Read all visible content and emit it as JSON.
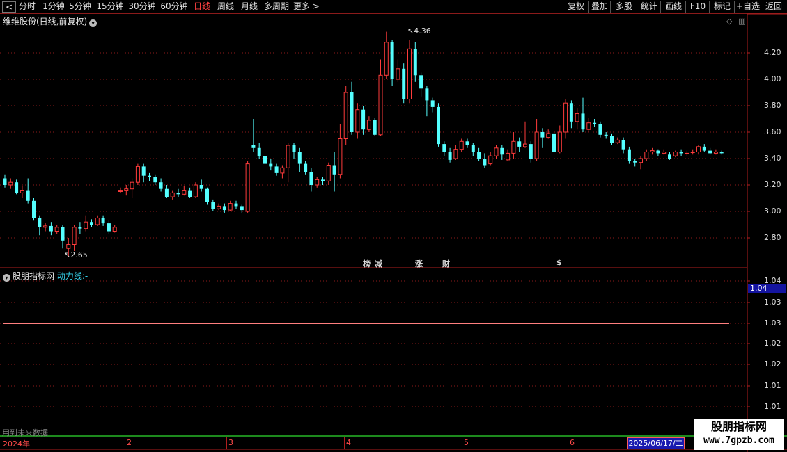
{
  "toolbar": {
    "periods": [
      {
        "label": "分时",
        "active": false
      },
      {
        "label": "1分钟",
        "active": false
      },
      {
        "label": "5分钟",
        "active": false
      },
      {
        "label": "15分钟",
        "active": false
      },
      {
        "label": "30分钟",
        "active": false
      },
      {
        "label": "60分钟",
        "active": false
      },
      {
        "label": "日线",
        "active": true
      },
      {
        "label": "周线",
        "active": false
      },
      {
        "label": "月线",
        "active": false
      },
      {
        "label": "多周期",
        "active": false
      },
      {
        "label": "更多",
        "active": false
      }
    ],
    "actions": [
      "复权",
      "叠加",
      "多股",
      "统计",
      "画线",
      "F10",
      "标记",
      "+自选",
      "返回"
    ]
  },
  "main_chart": {
    "title": "维维股份(日线,前复权)",
    "high_label": "4.36",
    "low_label": "2.65",
    "y_axis": [
      "4.20",
      "4.00",
      "3.80",
      "3.60",
      "3.40",
      "3.20",
      "3.00",
      "2.80"
    ],
    "markers": [
      {
        "text": "榜",
        "color": "#ff4040"
      },
      {
        "text": "减",
        "color": "#40e040"
      },
      {
        "text": "涨",
        "color": "#ff4040"
      },
      {
        "text": "财",
        "color": "#4080ff"
      },
      {
        "text": "$",
        "color": "#ff4040"
      }
    ]
  },
  "indicator": {
    "name": "股朋指标网",
    "line_label": "动力线:",
    "line_value": "-",
    "current_value": "1.04",
    "y_axis": [
      "1.04",
      "1.03",
      "1.03",
      "1.02",
      "1.02",
      "1.01",
      "1.01"
    ]
  },
  "footer": {
    "future_text": "用到未来数据",
    "dates": [
      "2024年",
      "2",
      "3",
      "4",
      "5",
      "6"
    ],
    "highlight_date": "2025/06/17/二"
  },
  "watermark": {
    "line1": "股朋指标网",
    "line2": "www.7gpzb.com"
  },
  "colors": {
    "up": "#ff3b3b",
    "down": "#54ffff",
    "grid": "#8b1a1a",
    "axis": "#b01e1e",
    "dynamic_line": "#ff7f7f"
  },
  "chart_data": {
    "type": "candlestick",
    "price_range": [
      2.6,
      4.4
    ],
    "candles": [
      [
        3.25,
        3.2,
        3.28,
        3.18
      ],
      [
        3.2,
        3.22,
        3.25,
        3.17
      ],
      [
        3.22,
        3.14,
        3.24,
        3.13
      ],
      [
        3.14,
        3.16,
        3.19,
        3.1
      ],
      [
        3.16,
        3.08,
        3.25,
        3.06
      ],
      [
        3.08,
        2.95,
        3.1,
        2.93
      ],
      [
        2.95,
        2.88,
        2.97,
        2.82
      ],
      [
        2.88,
        2.89,
        2.91,
        2.85
      ],
      [
        2.89,
        2.85,
        2.92,
        2.82
      ],
      [
        2.85,
        2.88,
        2.9,
        2.83
      ],
      [
        2.88,
        2.78,
        2.9,
        2.72
      ],
      [
        2.72,
        2.75,
        2.8,
        2.66
      ],
      [
        2.75,
        2.88,
        2.9,
        2.7
      ],
      [
        2.88,
        2.87,
        2.92,
        2.83
      ],
      [
        2.87,
        2.92,
        2.97,
        2.85
      ],
      [
        2.92,
        2.9,
        2.94,
        2.88
      ],
      [
        2.9,
        2.95,
        2.97,
        2.89
      ],
      [
        2.95,
        2.91,
        2.97,
        2.89
      ],
      [
        2.91,
        2.85,
        2.93,
        2.83
      ],
      [
        2.85,
        2.88,
        2.9,
        2.84
      ],
      [
        3.15,
        3.16,
        3.18,
        3.14
      ],
      [
        3.16,
        3.17,
        3.2,
        3.12
      ],
      [
        3.17,
        3.22,
        3.25,
        3.1
      ],
      [
        3.22,
        3.34,
        3.36,
        3.2
      ],
      [
        3.34,
        3.27,
        3.36,
        3.22
      ],
      [
        3.27,
        3.26,
        3.29,
        3.23
      ],
      [
        3.26,
        3.22,
        3.28,
        3.2
      ],
      [
        3.22,
        3.17,
        3.25,
        3.15
      ],
      [
        3.17,
        3.11,
        3.2,
        3.1
      ],
      [
        3.11,
        3.14,
        3.16,
        3.09
      ],
      [
        3.14,
        3.13,
        3.17,
        3.11
      ],
      [
        3.13,
        3.16,
        3.19,
        3.12
      ],
      [
        3.16,
        3.11,
        3.18,
        3.1
      ],
      [
        3.11,
        3.2,
        3.22,
        3.1
      ],
      [
        3.2,
        3.17,
        3.24,
        3.15
      ],
      [
        3.17,
        3.07,
        3.18,
        3.05
      ],
      [
        3.07,
        3.02,
        3.09,
        3.0
      ],
      [
        3.02,
        3.04,
        3.06,
        3.01
      ],
      [
        3.04,
        3.01,
        3.06,
        2.99
      ],
      [
        3.01,
        3.06,
        3.08,
        3.0
      ],
      [
        3.06,
        3.04,
        3.08,
        3.02
      ],
      [
        3.04,
        3.01,
        3.05,
        2.99
      ],
      [
        3.0,
        3.36,
        3.38,
        2.99
      ],
      [
        3.5,
        3.48,
        3.7,
        3.45
      ],
      [
        3.48,
        3.42,
        3.52,
        3.4
      ],
      [
        3.42,
        3.36,
        3.44,
        3.33
      ],
      [
        3.36,
        3.34,
        3.4,
        3.31
      ],
      [
        3.34,
        3.29,
        3.36,
        3.27
      ],
      [
        3.29,
        3.33,
        3.35,
        3.25
      ],
      [
        3.33,
        3.5,
        3.52,
        3.22
      ],
      [
        3.5,
        3.45,
        3.52,
        3.4
      ],
      [
        3.45,
        3.36,
        3.48,
        3.3
      ],
      [
        3.36,
        3.3,
        3.38,
        3.28
      ],
      [
        3.3,
        3.2,
        3.33,
        3.15
      ],
      [
        3.2,
        3.24,
        3.26,
        3.18
      ],
      [
        3.24,
        3.23,
        3.26,
        3.2
      ],
      [
        3.23,
        3.35,
        3.37,
        3.2
      ],
      [
        3.35,
        3.28,
        3.45,
        3.15
      ],
      [
        3.28,
        3.55,
        3.66,
        3.25
      ],
      [
        3.55,
        3.9,
        3.95,
        3.5
      ],
      [
        3.9,
        3.6,
        3.98,
        3.58
      ],
      [
        3.6,
        3.77,
        3.82,
        3.55
      ],
      [
        3.77,
        3.62,
        3.8,
        3.58
      ],
      [
        3.62,
        3.69,
        3.72,
        3.6
      ],
      [
        3.69,
        3.58,
        3.71,
        3.57
      ],
      [
        3.58,
        4.03,
        4.15,
        3.57
      ],
      [
        4.03,
        4.28,
        4.36,
        4.0
      ],
      [
        4.28,
        4.0,
        4.3,
        3.95
      ],
      [
        4.0,
        4.08,
        4.15,
        3.98
      ],
      [
        4.08,
        3.85,
        4.12,
        3.82
      ],
      [
        3.85,
        4.23,
        4.3,
        3.82
      ],
      [
        4.23,
        4.03,
        4.28,
        3.98
      ],
      [
        4.03,
        3.93,
        4.05,
        3.87
      ],
      [
        3.93,
        3.84,
        3.95,
        3.72
      ],
      [
        3.84,
        3.79,
        3.86,
        3.75
      ],
      [
        3.79,
        3.51,
        3.82,
        3.49
      ],
      [
        3.51,
        3.45,
        3.53,
        3.42
      ],
      [
        3.45,
        3.39,
        3.48,
        3.37
      ],
      [
        3.4,
        3.47,
        3.5,
        3.39
      ],
      [
        3.47,
        3.53,
        3.55,
        3.45
      ],
      [
        3.53,
        3.5,
        3.55,
        3.48
      ],
      [
        3.5,
        3.45,
        3.52,
        3.42
      ],
      [
        3.45,
        3.4,
        3.48,
        3.38
      ],
      [
        3.4,
        3.35,
        3.44,
        3.33
      ],
      [
        3.36,
        3.42,
        3.45,
        3.35
      ],
      [
        3.42,
        3.48,
        3.5,
        3.4
      ],
      [
        3.48,
        3.43,
        3.5,
        3.39
      ],
      [
        3.39,
        3.44,
        3.47,
        3.38
      ],
      [
        3.44,
        3.53,
        3.6,
        3.4
      ],
      [
        3.53,
        3.49,
        3.56,
        3.45
      ],
      [
        3.49,
        3.51,
        3.68,
        3.48
      ],
      [
        3.51,
        3.4,
        3.53,
        3.37
      ],
      [
        3.4,
        3.6,
        3.7,
        3.38
      ],
      [
        3.6,
        3.56,
        3.63,
        3.48
      ],
      [
        3.56,
        3.59,
        3.62,
        3.55
      ],
      [
        3.59,
        3.45,
        3.61,
        3.43
      ],
      [
        3.45,
        3.6,
        3.65,
        3.44
      ],
      [
        3.6,
        3.82,
        3.85,
        3.55
      ],
      [
        3.82,
        3.68,
        3.84,
        3.63
      ],
      [
        3.68,
        3.74,
        3.78,
        3.62
      ],
      [
        3.74,
        3.62,
        3.86,
        3.6
      ],
      [
        3.62,
        3.67,
        3.71,
        3.6
      ],
      [
        3.67,
        3.66,
        3.7,
        3.64
      ],
      [
        3.66,
        3.58,
        3.68,
        3.56
      ],
      [
        3.58,
        3.57,
        3.6,
        3.55
      ],
      [
        3.57,
        3.52,
        3.59,
        3.5
      ],
      [
        3.52,
        3.54,
        3.56,
        3.51
      ],
      [
        3.54,
        3.47,
        3.56,
        3.44
      ],
      [
        3.47,
        3.38,
        3.49,
        3.36
      ],
      [
        3.38,
        3.37,
        3.4,
        3.34
      ],
      [
        3.37,
        3.4,
        3.42,
        3.32
      ],
      [
        3.4,
        3.45,
        3.47,
        3.38
      ],
      [
        3.45,
        3.46,
        3.48,
        3.43
      ],
      [
        3.46,
        3.44,
        3.47,
        3.42
      ],
      [
        3.44,
        3.45,
        3.47,
        3.43
      ],
      [
        3.43,
        3.4,
        3.45,
        3.39
      ],
      [
        3.42,
        3.45,
        3.46,
        3.41
      ],
      [
        3.45,
        3.44,
        3.47,
        3.42
      ],
      [
        3.44,
        3.44,
        3.46,
        3.42
      ],
      [
        3.45,
        3.45,
        3.47,
        3.43
      ],
      [
        3.45,
        3.49,
        3.5,
        3.43
      ],
      [
        3.49,
        3.46,
        3.51,
        3.45
      ],
      [
        3.46,
        3.44,
        3.48,
        3.43
      ],
      [
        3.44,
        3.45,
        3.47,
        3.43
      ],
      [
        3.45,
        3.44,
        3.46,
        3.43
      ]
    ]
  }
}
